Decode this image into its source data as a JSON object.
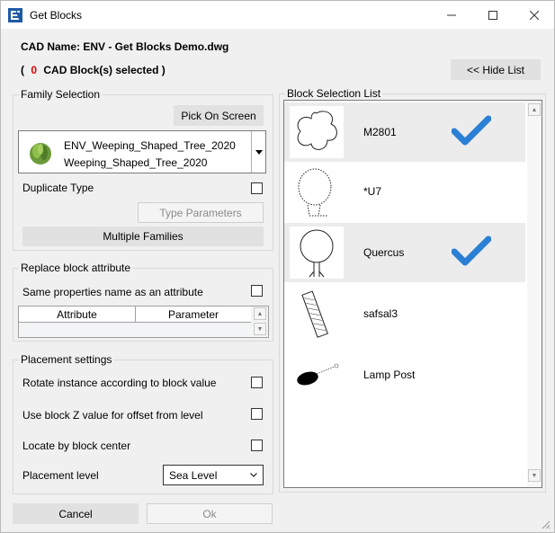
{
  "window": {
    "title": "Get Blocks",
    "controls": {
      "minimize": "—",
      "maximize": "☐",
      "close": "✕"
    }
  },
  "header": {
    "cad_name_label": "CAD Name: ENV - Get Blocks Demo.dwg",
    "selection_prefix": "(",
    "selection_count": "0",
    "selection_suffix": "CAD Block(s) selected )",
    "hide_list_button": "<< Hide List"
  },
  "family_selection": {
    "legend": "Family Selection",
    "pick_on_screen_button": "Pick On Screen",
    "family_name": "ENV_Weeping_Shaped_Tree_2020",
    "type_name": "Weeping_Shaped_Tree_2020",
    "duplicate_type_label": "Duplicate Type",
    "type_parameters_button": "Type Parameters",
    "multiple_families_button": "Multiple Families"
  },
  "replace_attribute": {
    "legend": "Replace block attribute",
    "same_properties_label": "Same properties name as an attribute",
    "columns": [
      "Attribute",
      "Parameter"
    ]
  },
  "placement": {
    "legend": "Placement settings",
    "rotate_label": "Rotate instance according to block value",
    "z_offset_label": "Use block Z value for offset from level",
    "locate_center_label": "Locate by block center",
    "level_label": "Placement level",
    "level_value": "Sea Level"
  },
  "block_list": {
    "legend": "Block Selection List",
    "items": [
      {
        "name": "M2801",
        "selected": true
      },
      {
        "name": "*U7",
        "selected": false
      },
      {
        "name": "Quercus",
        "selected": true
      },
      {
        "name": "safsal3",
        "selected": false
      },
      {
        "name": "Lamp Post",
        "selected": false
      }
    ]
  },
  "footer": {
    "cancel_button": "Cancel",
    "ok_button": "Ok"
  },
  "colors": {
    "accent_check": "#2b7fd4",
    "count_red": "#e00000",
    "button_bg": "#e1e1e1"
  }
}
